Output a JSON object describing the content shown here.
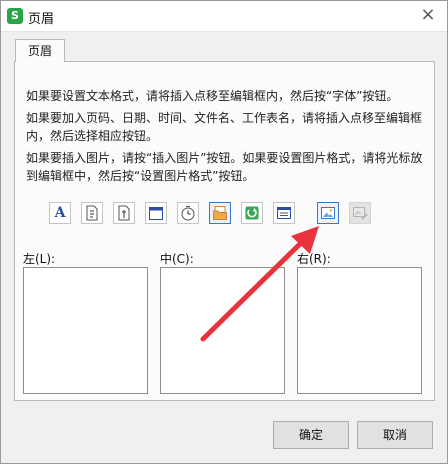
{
  "window": {
    "title": "页眉",
    "app_icon_glyph": "S",
    "close_glyph": "×"
  },
  "tab": {
    "label": "页眉"
  },
  "info": {
    "p1": "如果要设置文本格式，请将插入点移至编辑框内，然后按“字体”按钮。",
    "p2": "如果要加入页码、日期、时间、文件名、工作表名，请将插入点移至编辑框内，然后选择相应按钮。",
    "p3": "如果要插入图片，请按“插入图片”按钮。如果要设置图片格式，请将光标放到编辑框中，然后按“设置图片格式”按钮。"
  },
  "toolbar": {
    "font_glyph": "A",
    "date_glyph": "5",
    "items": [
      "font",
      "page-number",
      "page-count",
      "date",
      "time",
      "file-path",
      "file-name",
      "sheet-name",
      "insert-picture",
      "format-picture"
    ]
  },
  "sections": {
    "left_label": "左(L):",
    "center_label": "中(C):",
    "right_label": "右(R):"
  },
  "buttons": {
    "ok": "确定",
    "cancel": "取消"
  },
  "colors": {
    "accent": "#3a78c8",
    "arrow": "#e8323c",
    "app_icon": "#2aa34a"
  }
}
